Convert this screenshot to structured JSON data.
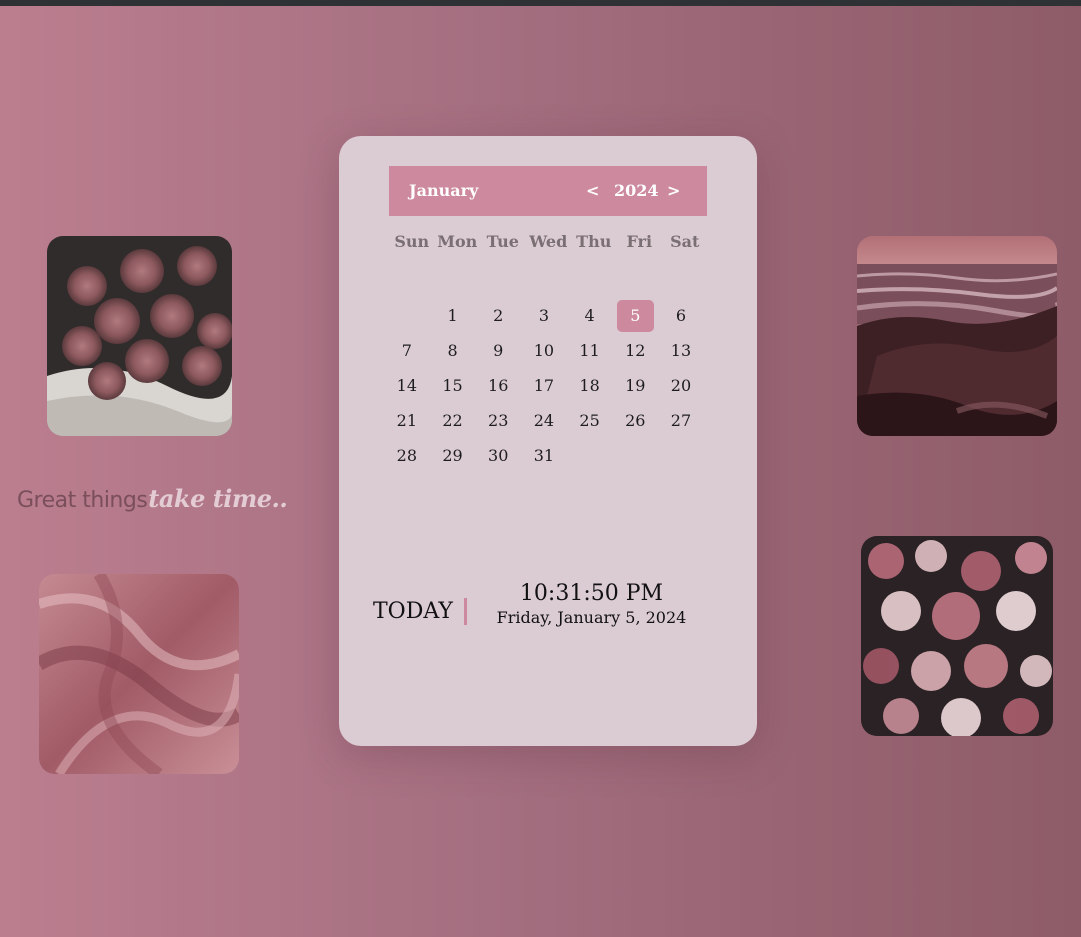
{
  "quote": {
    "plain": "Great things",
    "script": "take time.."
  },
  "calendar": {
    "month": "January",
    "year": "2024",
    "prev_label": "<",
    "next_label": ">",
    "weekdays": [
      "Sun",
      "Mon",
      "Tue",
      "Wed",
      "Thu",
      "Fri",
      "Sat"
    ],
    "leading_blanks": 1,
    "days": [
      "1",
      "2",
      "3",
      "4",
      "5",
      "6",
      "7",
      "8",
      "9",
      "10",
      "11",
      "12",
      "13",
      "14",
      "15",
      "16",
      "17",
      "18",
      "19",
      "20",
      "21",
      "22",
      "23",
      "24",
      "25",
      "26",
      "27",
      "28",
      "29",
      "30",
      "31"
    ],
    "selected_day": "5"
  },
  "today_panel": {
    "label": "TODAY",
    "time": "10:31:50 PM",
    "date": "Friday, January 5, 2024"
  },
  "photos": {
    "roses": "pink-roses-photo",
    "sea": "rocky-seashore-photo",
    "silk": "pink-silk-fabric-photo",
    "bouquet": "floral-arrangement-photo"
  },
  "colors": {
    "accent": "#cd8a9e",
    "card": "#dbcbd2",
    "background_left": "#bb7e8f",
    "background_right": "#8e5b68"
  }
}
